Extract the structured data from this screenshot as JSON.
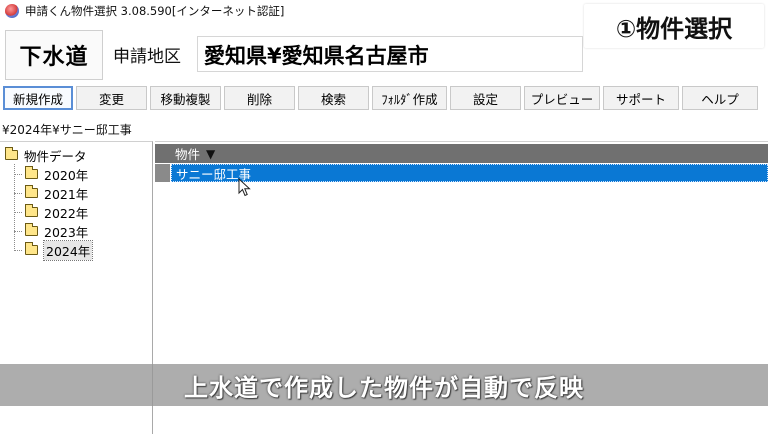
{
  "window": {
    "title": "申請くん物件選択 3.08.590[インターネット認証]"
  },
  "overlay": {
    "step_label": "①物件選択",
    "caption": "上水道で作成した物件が自動で反映"
  },
  "header": {
    "system_name": "下水道",
    "area_label": "申請地区",
    "area_value": "愛知県¥愛知県名古屋市"
  },
  "toolbar": {
    "buttons": [
      {
        "label": "新規作成"
      },
      {
        "label": "変更"
      },
      {
        "label": "移動複製"
      },
      {
        "label": "削除"
      },
      {
        "label": "検索"
      },
      {
        "label": "ﾌｫﾙﾀﾞ作成"
      },
      {
        "label": "設定"
      },
      {
        "label": "プレビュー"
      },
      {
        "label": "サポート"
      },
      {
        "label": "ヘルプ"
      }
    ]
  },
  "breadcrumb": {
    "path": "¥2024年¥サニー邸工事"
  },
  "tree": {
    "root_label": "物件データ",
    "items": [
      {
        "label": "2020年"
      },
      {
        "label": "2021年"
      },
      {
        "label": "2022年"
      },
      {
        "label": "2023年"
      },
      {
        "label": "2024年"
      }
    ],
    "selected": "2024年"
  },
  "list": {
    "column_header": "物件",
    "sort_indicator": "▼",
    "rows": [
      {
        "name": "サニー邸工事"
      }
    ]
  },
  "colors": {
    "selection": "#0a78d4",
    "header_bg": "#707070",
    "caption_band": "#969696",
    "folder": "#ffe68a"
  }
}
